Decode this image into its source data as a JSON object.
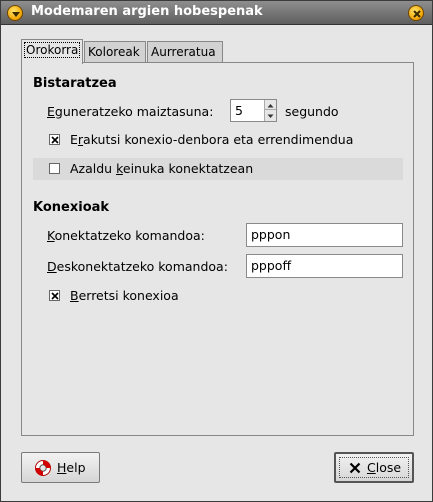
{
  "window": {
    "title": "Modemaren argien hobespenak",
    "menu_icon": "window-menu-icon",
    "close_icon": "close-icon"
  },
  "tabs": [
    {
      "label": "Orokorra",
      "active": true
    },
    {
      "label": "Koloreak",
      "active": false
    },
    {
      "label": "Aurreratua",
      "active": false
    }
  ],
  "display": {
    "heading": "Bistaratzea",
    "update_label_mn": "E",
    "update_label_rest": "guneratzeko maiztasuna:",
    "update_value": "5",
    "update_unit": "segundo",
    "show_conn_mn": "r",
    "show_conn_pre": "E",
    "show_conn_rest": "akutsi konexio-denbora eta errendimendua",
    "show_conn_checked": true,
    "blink_pre": "Azaldu ",
    "blink_mn": "k",
    "blink_rest": "einuka konektatzean",
    "blink_checked": false
  },
  "connection": {
    "heading": "Konexioak",
    "connect_mn": "K",
    "connect_rest": "onektatzeko komandoa:",
    "connect_value": "pppon",
    "disconnect_mn": "D",
    "disconnect_rest": "eskonektatzeko komandoa:",
    "disconnect_value": "pppoff",
    "confirm_mn": "B",
    "confirm_rest": "erretsi konexioa",
    "confirm_checked": true
  },
  "buttons": {
    "help_mn": "H",
    "help_rest": "elp",
    "help_icon": "lifebuoy-icon",
    "close_mn": "C",
    "close_rest": "lose",
    "close_icon": "x-close-icon"
  },
  "colors": {
    "titlebar": "#6f6f6f",
    "title_button": "#f2a400"
  }
}
